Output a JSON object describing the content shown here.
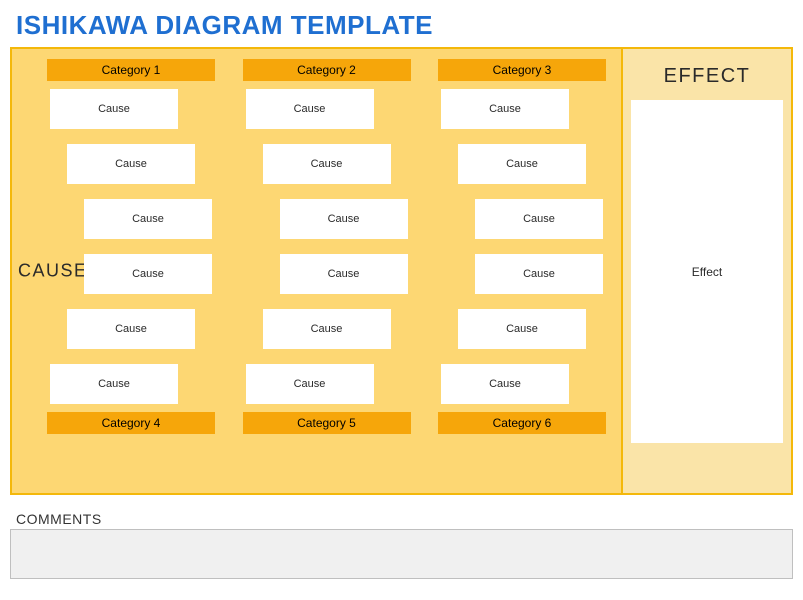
{
  "title": "ISHIKAWA DIAGRAM TEMPLATE",
  "cause_label": "CAUSE",
  "effect_label": "EFFECT",
  "effect_box": "Effect",
  "categories_top": [
    "Category 1",
    "Category 2",
    "Category 3"
  ],
  "categories_bottom": [
    "Category 4",
    "Category 5",
    "Category 6"
  ],
  "cause_text": "Cause",
  "rows": [
    [
      "Cause",
      "Cause",
      "Cause"
    ],
    [
      "Cause",
      "Cause",
      "Cause"
    ],
    [
      "Cause",
      "Cause",
      "Cause"
    ],
    [
      "Cause",
      "Cause",
      "Cause"
    ],
    [
      "Cause",
      "Cause",
      "Cause"
    ],
    [
      "Cause",
      "Cause",
      "Cause"
    ]
  ],
  "comments_label": "COMMENTS",
  "comments_value": ""
}
